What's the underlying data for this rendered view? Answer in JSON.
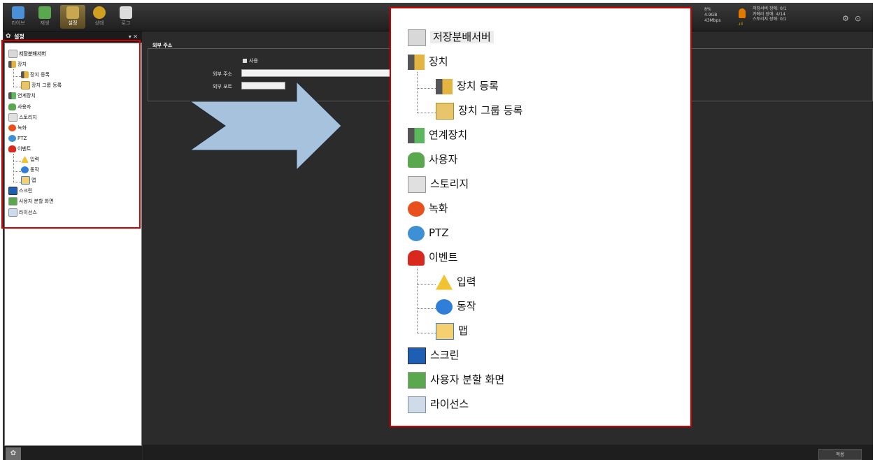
{
  "toolbar": {
    "buttons": [
      {
        "label": "라이브"
      },
      {
        "label": "재생"
      },
      {
        "label": "설정"
      },
      {
        "label": "상태"
      },
      {
        "label": "로그"
      }
    ],
    "stats": [
      "8%",
      "4.9GB",
      "43Mbps"
    ],
    "status_lines": [
      "저장서버 장애: 0/1",
      "카메라 장애: 4/14",
      "스토리지 장애: 0/1"
    ]
  },
  "left_panel": {
    "title": "설정",
    "controls": "▾ ✕",
    "tree": [
      {
        "label": "저장분배서버",
        "level": 0,
        "icon": "server-icon",
        "selected": true
      },
      {
        "label": "장치",
        "level": 0,
        "icon": "camera-icon"
      },
      {
        "label": "장치 등록",
        "level": 1,
        "icon": "camera-add-icon"
      },
      {
        "label": "장치 그룹 등록",
        "level": 1,
        "icon": "device-group-icon"
      },
      {
        "label": "연계장치",
        "level": 0,
        "icon": "linked-device-icon"
      },
      {
        "label": "사용자",
        "level": 0,
        "icon": "user-icon"
      },
      {
        "label": "스토리지",
        "level": 0,
        "icon": "storage-icon"
      },
      {
        "label": "녹화",
        "level": 0,
        "icon": "record-icon"
      },
      {
        "label": "PTZ",
        "level": 0,
        "icon": "ptz-icon"
      },
      {
        "label": "이벤트",
        "level": 0,
        "icon": "siren-icon"
      },
      {
        "label": "입력",
        "level": 1,
        "icon": "warning-icon"
      },
      {
        "label": "동작",
        "level": 1,
        "icon": "action-check-icon"
      },
      {
        "label": "맵",
        "level": 1,
        "icon": "map-icon"
      },
      {
        "label": "스크린",
        "level": 0,
        "icon": "monitor-icon"
      },
      {
        "label": "사용자 분할 화면",
        "level": 0,
        "icon": "user-split-icon"
      },
      {
        "label": "라이선스",
        "level": 0,
        "icon": "license-icon"
      }
    ]
  },
  "settings": {
    "section_title": "외부 주소",
    "use_label": "사용",
    "address_label": "외부 주소",
    "port_label": "외부 포트",
    "address_value": "",
    "port_value": ""
  },
  "footer": {
    "apply_label": "적용"
  },
  "colors": {
    "highlight_border": "#d00000",
    "arrow_fill": "#a7c2dc"
  }
}
